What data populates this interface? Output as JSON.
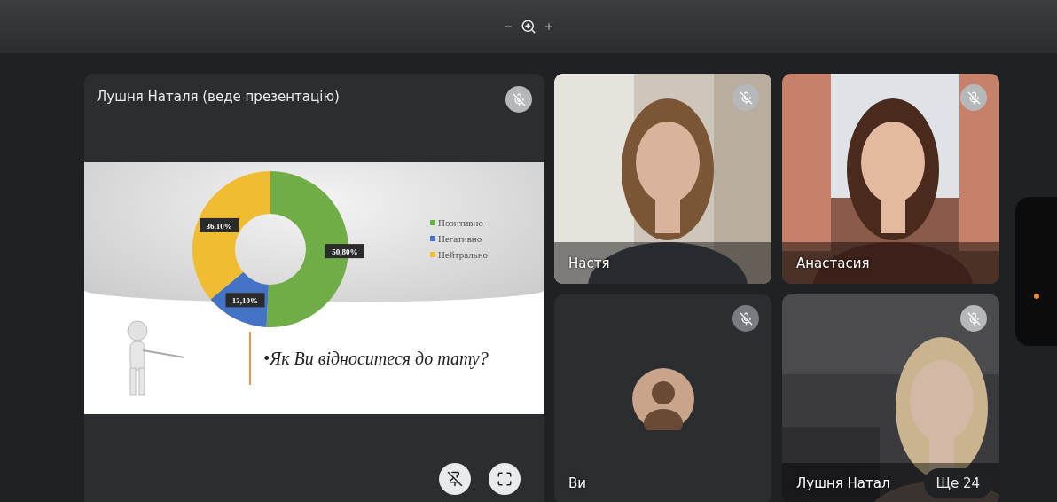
{
  "presenter": {
    "name": "Лушня Наталя (веде презентацію)",
    "muted": true,
    "slide": {
      "chart_data": {
        "type": "donut",
        "categories": [
          "Позитивно",
          "Негативно",
          "Нейтрально"
        ],
        "colors": [
          "#70ad47",
          "#4472c4",
          "#f0bc32"
        ],
        "series": [
          {
            "values": [
              50.8,
              13.1,
              36.1
            ]
          }
        ],
        "value_labels": [
          "50,80%",
          "13,10%",
          "36,10%"
        ]
      },
      "question": "•Як Ви відноситеся до тату?"
    }
  },
  "participants": [
    {
      "name": "Настя",
      "kind": "video",
      "muted": true
    },
    {
      "name": "Анастасия",
      "kind": "video",
      "muted": true
    },
    {
      "name": "Ви",
      "kind": "avatar",
      "muted": true
    },
    {
      "name": "Лушня Натал",
      "kind": "video",
      "muted": true
    }
  ],
  "more_badge": "Ще 24",
  "side_panel": {
    "notification": true
  }
}
